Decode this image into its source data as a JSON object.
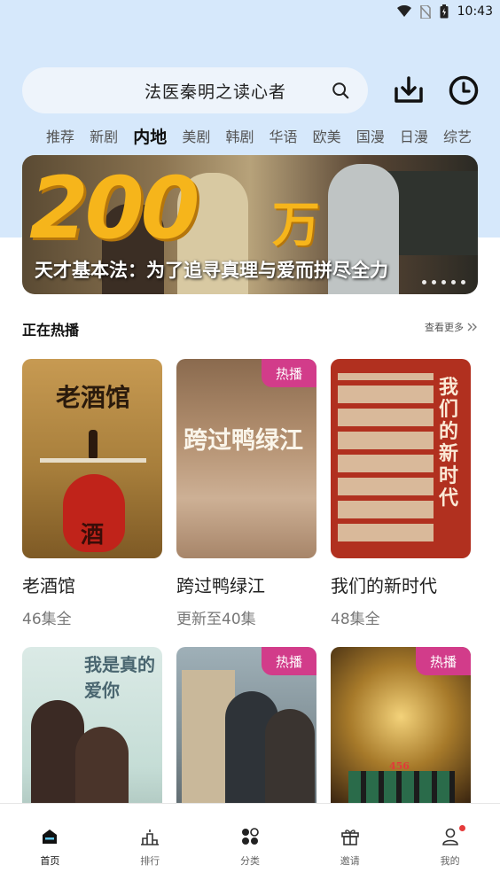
{
  "status_bar": {
    "time": "10:43"
  },
  "search": {
    "query": "法医秦明之读心者"
  },
  "tabs": [
    {
      "label": "推荐",
      "active": false
    },
    {
      "label": "新剧",
      "active": false
    },
    {
      "label": "内地",
      "active": true
    },
    {
      "label": "美剧",
      "active": false
    },
    {
      "label": "韩剧",
      "active": false
    },
    {
      "label": "华语",
      "active": false
    },
    {
      "label": "欧美",
      "active": false
    },
    {
      "label": "国漫",
      "active": false
    },
    {
      "label": "日漫",
      "active": false
    },
    {
      "label": "综艺",
      "active": false
    }
  ],
  "banner": {
    "big_number": "200",
    "big_unit": "万",
    "caption": "天才基本法：为了追寻真理与爱而拼尽全力",
    "page_count": 5
  },
  "section": {
    "title": "正在热播",
    "more_label": "查看更多"
  },
  "hot_badge": "热播",
  "cards": [
    {
      "title": "老酒馆",
      "subtitle": "46集全",
      "poster_text": "老酒馆",
      "poster_seal": "酒",
      "hot": false,
      "poster_color": "#b48a45"
    },
    {
      "title": "跨过鸭绿江",
      "subtitle": "更新至40集",
      "poster_text": "跨过鸭绿江",
      "hot": true,
      "poster_color": "#a07c60"
    },
    {
      "title": "我们的新时代",
      "subtitle": "48集全",
      "poster_text": "我们的新时代",
      "hot": false,
      "poster_color": "#b0301f"
    },
    {
      "title": "",
      "subtitle": "",
      "poster_text": "我是真的爱你",
      "hot": false,
      "poster_color": "#cfe3de"
    },
    {
      "title": "",
      "subtitle": "",
      "poster_text": "",
      "hot": true,
      "poster_color": "#6f7d85"
    },
    {
      "title": "",
      "subtitle": "",
      "poster_text": "456",
      "hot": true,
      "poster_color": "#6b4a1e"
    }
  ],
  "bottom_nav": [
    {
      "label": "首页",
      "icon": "home-icon",
      "active": true
    },
    {
      "label": "排行",
      "icon": "ranking-icon",
      "active": false
    },
    {
      "label": "分类",
      "icon": "category-icon",
      "active": false
    },
    {
      "label": "邀请",
      "icon": "gift-icon",
      "active": false
    },
    {
      "label": "我的",
      "icon": "profile-icon",
      "active": false,
      "badge": true
    }
  ]
}
